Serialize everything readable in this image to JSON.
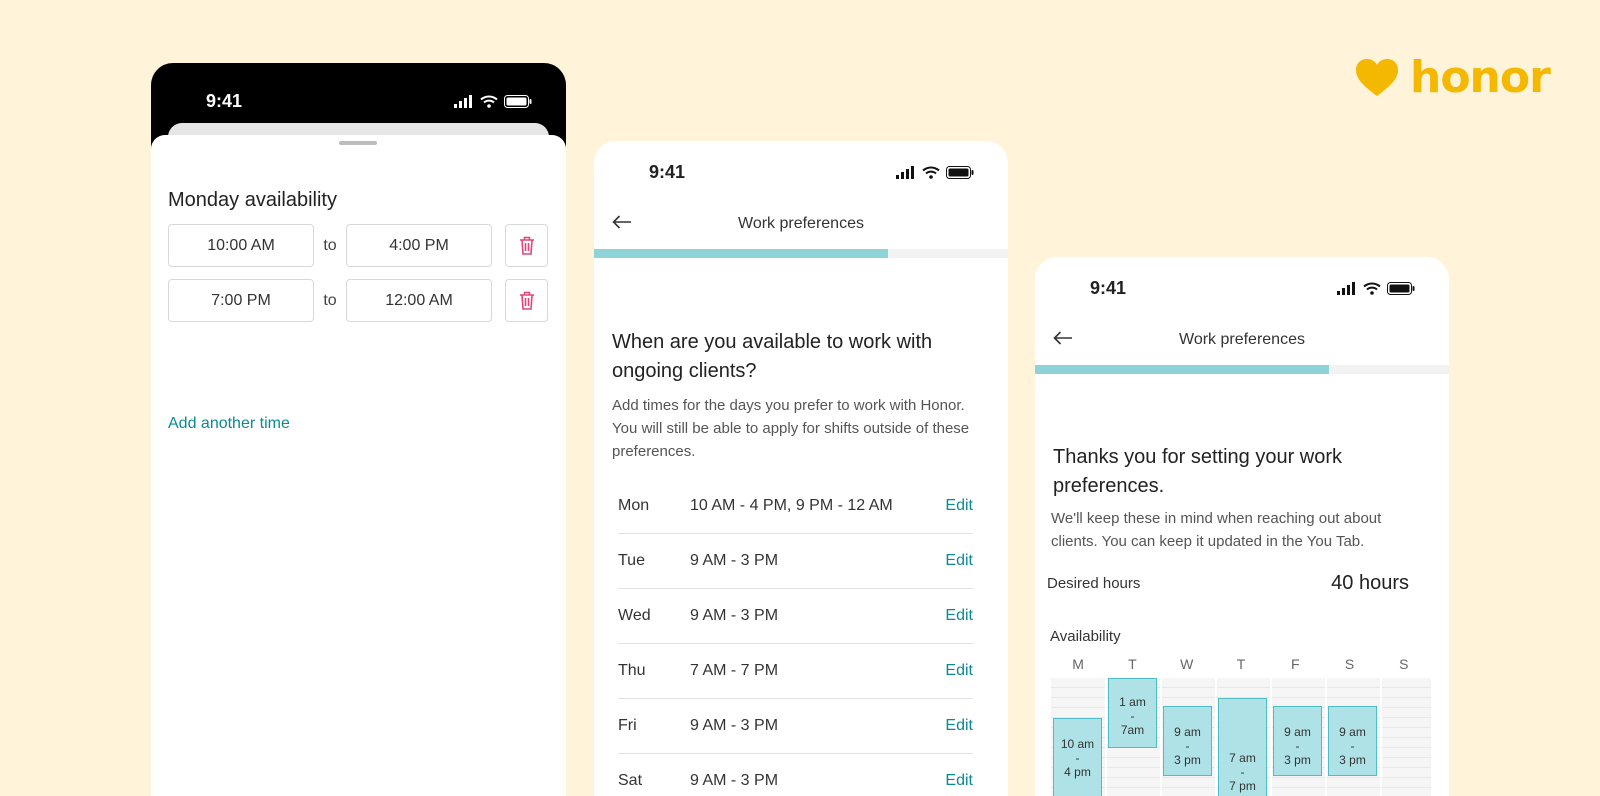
{
  "brand": {
    "name": "honor",
    "color": "#f5b800",
    "icon": "heart-icon"
  },
  "status_bar": {
    "time": "9:41",
    "icons": [
      "signal-icon",
      "wifi-icon",
      "battery-icon"
    ]
  },
  "phone1": {
    "sheet_title": "Monday availability",
    "rows": [
      {
        "start": "10:00 AM",
        "sep": "to",
        "end": "4:00 PM"
      },
      {
        "start": "7:00 PM",
        "sep": "to",
        "end": "12:00 AM"
      }
    ],
    "add_time": "Add another time"
  },
  "phone2": {
    "nav_title": "Work preferences",
    "progress": 0.71,
    "question": "When are you available to work with ongoing clients?",
    "description": "Add times for the days you prefer to work with Honor. You will still be able to apply for shifts outside of these preferences.",
    "days": [
      {
        "day": "Mon",
        "hours": "10 AM - 4 PM,  9 PM - 12 AM",
        "action": "Edit"
      },
      {
        "day": "Tue",
        "hours": "9 AM - 3 PM",
        "action": "Edit"
      },
      {
        "day": "Wed",
        "hours": "9 AM - 3 PM",
        "action": "Edit"
      },
      {
        "day": "Thu",
        "hours": "7 AM - 7 PM",
        "action": "Edit"
      },
      {
        "day": "Fri",
        "hours": "9 AM - 3 PM",
        "action": "Edit"
      },
      {
        "day": "Sat",
        "hours": "9 AM - 3 PM",
        "action": "Edit"
      }
    ]
  },
  "phone3": {
    "nav_title": "Work preferences",
    "progress": 0.71,
    "title": "Thanks you for setting your work preferences.",
    "description": "We'll keep these in mind when reaching out about clients. You can keep it updated in the You Tab.",
    "desired_hours_label": "Desired hours",
    "desired_hours_value": "40 hours",
    "availability_label": "Availability",
    "week_days": [
      "M",
      "T",
      "W",
      "T",
      "F",
      "S",
      "S"
    ],
    "blocks": [
      {
        "day": 0,
        "lines": [
          "10 am",
          "-",
          "4 pm"
        ]
      },
      {
        "day": 1,
        "lines": [
          "1 am",
          "-",
          "7am"
        ]
      },
      {
        "day": 2,
        "lines": [
          "9 am",
          "-",
          "3 pm"
        ]
      },
      {
        "day": 3,
        "lines": [
          "7 am",
          "-",
          "7 pm"
        ]
      },
      {
        "day": 4,
        "lines": [
          "9 am",
          "-",
          "3 pm"
        ]
      },
      {
        "day": 5,
        "lines": [
          "9 am",
          "-",
          "3 pm"
        ]
      }
    ]
  }
}
